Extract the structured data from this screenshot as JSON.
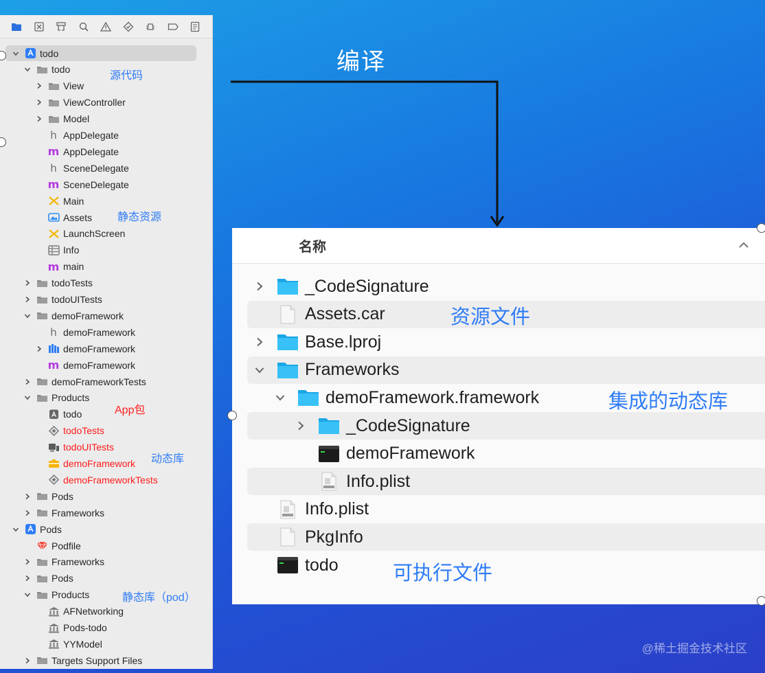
{
  "navigator": {
    "toolbar_icons": [
      "folder-icon",
      "source-control-icon",
      "symbol-icon",
      "search-icon",
      "warning-icon",
      "test-icon",
      "debug-icon",
      "breakpoint-icon",
      "report-icon"
    ],
    "items": [
      {
        "label": "todo",
        "depth": 0,
        "disc": "down",
        "icon": "xcodeproj-icon",
        "selected": true
      },
      {
        "label": "todo",
        "depth": 1,
        "disc": "down",
        "icon": "folder-icon"
      },
      {
        "label": "View",
        "depth": 2,
        "disc": "right",
        "icon": "folder-icon"
      },
      {
        "label": "ViewController",
        "depth": 2,
        "disc": "right",
        "icon": "folder-icon"
      },
      {
        "label": "Model",
        "depth": 2,
        "disc": "right",
        "icon": "folder-icon"
      },
      {
        "label": "AppDelegate",
        "depth": 2,
        "disc": "none",
        "icon": "header-file-icon"
      },
      {
        "label": "AppDelegate",
        "depth": 2,
        "disc": "none",
        "icon": "objc-file-icon"
      },
      {
        "label": "SceneDelegate",
        "depth": 2,
        "disc": "none",
        "icon": "header-file-icon"
      },
      {
        "label": "SceneDelegate",
        "depth": 2,
        "disc": "none",
        "icon": "objc-file-icon"
      },
      {
        "label": "Main",
        "depth": 2,
        "disc": "none",
        "icon": "storyboard-icon"
      },
      {
        "label": "Assets",
        "depth": 2,
        "disc": "none",
        "icon": "assets-icon"
      },
      {
        "label": "LaunchScreen",
        "depth": 2,
        "disc": "none",
        "icon": "storyboard-icon"
      },
      {
        "label": "Info",
        "depth": 2,
        "disc": "none",
        "icon": "plist-icon"
      },
      {
        "label": "main",
        "depth": 2,
        "disc": "none",
        "icon": "objc-file-icon"
      },
      {
        "label": "todoTests",
        "depth": 1,
        "disc": "right",
        "icon": "folder-icon"
      },
      {
        "label": "todoUITests",
        "depth": 1,
        "disc": "right",
        "icon": "folder-icon"
      },
      {
        "label": "demoFramework",
        "depth": 1,
        "disc": "down",
        "icon": "folder-icon"
      },
      {
        "label": "demoFramework",
        "depth": 2,
        "disc": "none",
        "icon": "header-file-icon"
      },
      {
        "label": "demoFramework",
        "depth": 2,
        "disc": "right",
        "icon": "framework-target-icon"
      },
      {
        "label": "demoFramework",
        "depth": 2,
        "disc": "none",
        "icon": "objc-file-icon"
      },
      {
        "label": "demoFrameworkTests",
        "depth": 1,
        "disc": "right",
        "icon": "folder-icon"
      },
      {
        "label": "Products",
        "depth": 1,
        "disc": "down",
        "icon": "folder-icon"
      },
      {
        "label": "todo",
        "depth": 2,
        "disc": "none",
        "icon": "app-product-icon"
      },
      {
        "label": "todoTests",
        "depth": 2,
        "disc": "none",
        "icon": "test-bundle-icon",
        "red": true
      },
      {
        "label": "todoUITests",
        "depth": 2,
        "disc": "none",
        "icon": "ui-test-bundle-icon",
        "red": true
      },
      {
        "label": "demoFramework",
        "depth": 2,
        "disc": "none",
        "icon": "framework-product-icon",
        "red": true
      },
      {
        "label": "demoFrameworkTests",
        "depth": 2,
        "disc": "none",
        "icon": "test-bundle-icon",
        "red": true
      },
      {
        "label": "Pods",
        "depth": 1,
        "disc": "right",
        "icon": "folder-icon"
      },
      {
        "label": "Frameworks",
        "depth": 1,
        "disc": "right",
        "icon": "folder-icon"
      },
      {
        "label": "Pods",
        "depth": 0,
        "disc": "down",
        "icon": "xcodeproj-icon"
      },
      {
        "label": "Podfile",
        "depth": 1,
        "disc": "none",
        "icon": "ruby-gem-icon"
      },
      {
        "label": "Frameworks",
        "depth": 1,
        "disc": "right",
        "icon": "folder-icon"
      },
      {
        "label": "Pods",
        "depth": 1,
        "disc": "right",
        "icon": "folder-icon"
      },
      {
        "label": "Products",
        "depth": 1,
        "disc": "down",
        "icon": "folder-icon"
      },
      {
        "label": "AFNetworking",
        "depth": 2,
        "disc": "none",
        "icon": "static-library-icon"
      },
      {
        "label": "Pods-todo",
        "depth": 2,
        "disc": "none",
        "icon": "static-library-icon"
      },
      {
        "label": "YYModel",
        "depth": 2,
        "disc": "none",
        "icon": "static-library-icon"
      },
      {
        "label": "Targets Support Files",
        "depth": 1,
        "disc": "right",
        "icon": "folder-icon"
      }
    ],
    "annotations": {
      "source_code": "源代码",
      "static_resources": "静态资源",
      "app_package": "App包",
      "dynamic_library": "动态库",
      "static_library_pod": "静态库（pod）"
    }
  },
  "compile_label": "编译",
  "finder": {
    "column_header": "名称",
    "items": [
      {
        "label": "_CodeSignature",
        "depth": 0,
        "disc": "right",
        "icon": "folder-icon",
        "stripe": false
      },
      {
        "label": "Assets.car",
        "depth": 0,
        "disc": "none",
        "icon": "document-icon",
        "stripe": true
      },
      {
        "label": "Base.lproj",
        "depth": 0,
        "disc": "right",
        "icon": "folder-icon",
        "stripe": false
      },
      {
        "label": "Frameworks",
        "depth": 0,
        "disc": "down",
        "icon": "folder-icon",
        "stripe": true
      },
      {
        "label": "demoFramework.framework",
        "depth": 1,
        "disc": "down",
        "icon": "folder-icon",
        "stripe": false
      },
      {
        "label": "_CodeSignature",
        "depth": 2,
        "disc": "right",
        "icon": "folder-icon",
        "stripe": true
      },
      {
        "label": "demoFramework",
        "depth": 2,
        "disc": "none",
        "icon": "exec-icon",
        "stripe": false
      },
      {
        "label": "Info.plist",
        "depth": 2,
        "disc": "none",
        "icon": "plist-doc-icon",
        "stripe": true
      },
      {
        "label": "Info.plist",
        "depth": 0,
        "disc": "none",
        "icon": "plist-doc-icon",
        "stripe": false
      },
      {
        "label": "PkgInfo",
        "depth": 0,
        "disc": "none",
        "icon": "document-icon",
        "stripe": true
      },
      {
        "label": "todo",
        "depth": 0,
        "disc": "none",
        "icon": "exec-icon",
        "stripe": false
      }
    ],
    "annotations": {
      "resource_file": "资源文件",
      "integrated_dynamic_library": "集成的动态库",
      "executable_file": "可执行文件"
    }
  },
  "watermark": "@稀土掘金技术社区",
  "colors": {
    "accent_blue": "#2f7cf6",
    "missing_red": "#ff1a1a",
    "finder_folder": "#29b6f0"
  }
}
